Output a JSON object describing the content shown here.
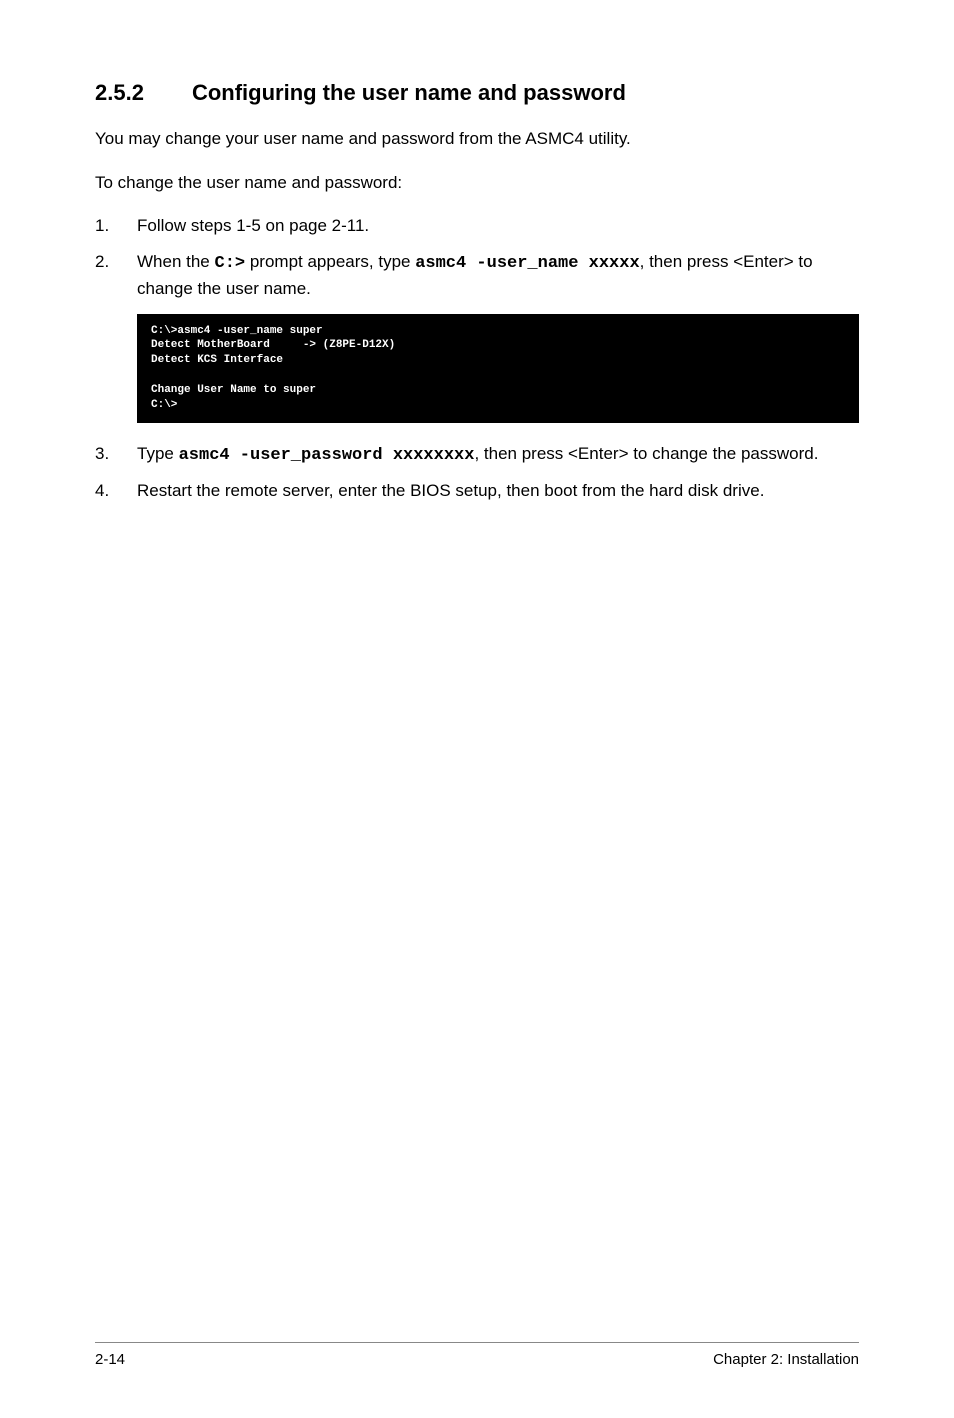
{
  "heading": {
    "number": "2.5.2",
    "title": "Configuring the user name and password"
  },
  "paragraphs": {
    "intro1": "You may change your user name and password from the ASMC4 utility.",
    "intro2": "To change the user name and password:"
  },
  "steps": {
    "s1": {
      "num": "1.",
      "text": "Follow steps 1-5 on page 2-11."
    },
    "s2": {
      "num": "2.",
      "pre": "When the ",
      "code1": "C:>",
      "mid1": " prompt appears, type ",
      "code2": "asmc4 -user_name xxxxx",
      "post": ", then press <Enter> to change the user name."
    },
    "s3": {
      "num": "3.",
      "pre": "Type ",
      "code1": "asmc4 -user_password xxxxxxxx",
      "post": ", then press <Enter> to change the password."
    },
    "s4": {
      "num": "4.",
      "text": "Restart the remote server, enter the BIOS setup, then boot from the hard disk drive."
    }
  },
  "terminal": "C:\\>asmc4 -user_name super\nDetect MotherBoard     -> (Z8PE-D12X)\nDetect KCS Interface\n\nChange User Name to super\nC:\\>",
  "footer": {
    "left": "2-14",
    "right": "Chapter 2: Installation"
  }
}
